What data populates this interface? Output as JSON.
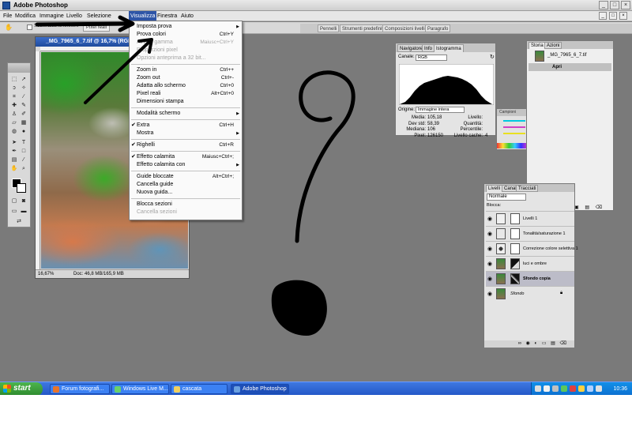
{
  "app": {
    "title": "Adobe Photoshop",
    "window_buttons": [
      "_",
      "□",
      "×"
    ]
  },
  "menubar": {
    "items": [
      "File",
      "Modifica",
      "Immagine",
      "Livello",
      "Selezione",
      "Visualizza",
      "Finestra",
      "Aiuto"
    ],
    "active": "Visualizza"
  },
  "options_bar": {
    "checkbox_label": "Scorri tutte le finestre",
    "button_label": "Pixel reali"
  },
  "palette_well": [
    "Pennelli",
    "Strumenti predefiniti",
    "Composizioni livelli",
    "Paragrafo"
  ],
  "document": {
    "title": "_MG_7965_6_7.tif @ 16,7% (RGB/16)",
    "zoom": "16,67%",
    "doc_size": "Doc: 46,8 MB/165,9 MB"
  },
  "view_menu": [
    {
      "type": "item",
      "label": "Imposta prova",
      "submenu": true
    },
    {
      "type": "item",
      "label": "Prova colori",
      "shortcut": "Ctrl+Y"
    },
    {
      "type": "item",
      "label": "Avviso gamma",
      "shortcut": "Maiusc+Ctrl+Y",
      "disabled": true
    },
    {
      "type": "item",
      "label": "Proporzioni pixel",
      "disabled": true
    },
    {
      "type": "item",
      "label": "Opzioni anteprima a 32 bit...",
      "disabled": true
    },
    {
      "type": "sep"
    },
    {
      "type": "item",
      "label": "Zoom in",
      "shortcut": "Ctrl++"
    },
    {
      "type": "item",
      "label": "Zoom out",
      "shortcut": "Ctrl+-"
    },
    {
      "type": "item",
      "label": "Adatta allo schermo",
      "shortcut": "Ctrl+0"
    },
    {
      "type": "item",
      "label": "Pixel reali",
      "shortcut": "Alt+Ctrl+0"
    },
    {
      "type": "item",
      "label": "Dimensioni stampa"
    },
    {
      "type": "sep"
    },
    {
      "type": "item",
      "label": "Modalità schermo",
      "submenu": true
    },
    {
      "type": "sep"
    },
    {
      "type": "item",
      "label": "Extra",
      "shortcut": "Ctrl+H",
      "checked": true
    },
    {
      "type": "item",
      "label": "Mostra",
      "submenu": true
    },
    {
      "type": "sep"
    },
    {
      "type": "item",
      "label": "Righelli",
      "shortcut": "Ctrl+R",
      "checked": true
    },
    {
      "type": "sep"
    },
    {
      "type": "item",
      "label": "Effetto calamita",
      "shortcut": "Maiusc+Ctrl+;",
      "checked": true
    },
    {
      "type": "item",
      "label": "Effetto calamita con",
      "submenu": true
    },
    {
      "type": "sep"
    },
    {
      "type": "item",
      "label": "Guide bloccate",
      "shortcut": "Alt+Ctrl+;"
    },
    {
      "type": "item",
      "label": "Cancella guide"
    },
    {
      "type": "item",
      "label": "Nuova guida..."
    },
    {
      "type": "sep"
    },
    {
      "type": "item",
      "label": "Blocca sezioni"
    },
    {
      "type": "item",
      "label": "Cancella sezioni",
      "disabled": true
    }
  ],
  "histogram": {
    "tabs": [
      "Navigatore",
      "Info",
      "Istogramma"
    ],
    "active_tab": "Istogramma",
    "channel_label": "Canale:",
    "channel_value": "RGB",
    "source_label": "Origine:",
    "source_value": "Immagine intera",
    "stats": [
      {
        "label": "Media:",
        "value": "105,18"
      },
      {
        "label": "Dev std:",
        "value": "58,39"
      },
      {
        "label": "Mediana:",
        "value": "106"
      },
      {
        "label": "Pixel:",
        "value": "126150"
      }
    ],
    "stats_right": [
      {
        "label": "Livello:",
        "value": ""
      },
      {
        "label": "Quantità:",
        "value": ""
      },
      {
        "label": "Percentile:",
        "value": ""
      },
      {
        "label": "Livello cache:",
        "value": "4"
      }
    ]
  },
  "color_panel": {
    "tab": "Campioni",
    "bar_colors": [
      "#00c8e0",
      "#d040c8",
      "#e8e020"
    ]
  },
  "history": {
    "tabs": [
      "Storia",
      "Azioni"
    ],
    "active_tab": "Storia",
    "snapshot_name": "_MG_7965_6_7.tif",
    "state": "Apri"
  },
  "layers": {
    "tabs": [
      "Livelli",
      "Canali",
      "Tracciati"
    ],
    "active_tab": "Livelli",
    "blend_mode": "Normale",
    "lock_label": "Blocca:",
    "items": [
      {
        "name": "Livelli 1",
        "selected": false
      },
      {
        "name": "Tonalità/saturazione 1",
        "selected": false
      },
      {
        "name": "Correzione colore selettiva 1",
        "selected": false
      },
      {
        "name": "luci e ombre",
        "selected": false
      },
      {
        "name": "Sfondo copia",
        "selected": true
      },
      {
        "name": "Sfondo",
        "selected": false
      }
    ],
    "footer_icons": "∞ ◉ ◐ ▭ ▤ ⌫"
  },
  "taskbar": {
    "start_label": "start",
    "tasks": [
      {
        "label": "Forum fotografi...",
        "active": false
      },
      {
        "label": "Windows Live M...",
        "active": false
      },
      {
        "label": "cascata",
        "active": false
      },
      {
        "label": "Adobe Photoshop",
        "active": true
      }
    ],
    "clock": "10:36"
  }
}
